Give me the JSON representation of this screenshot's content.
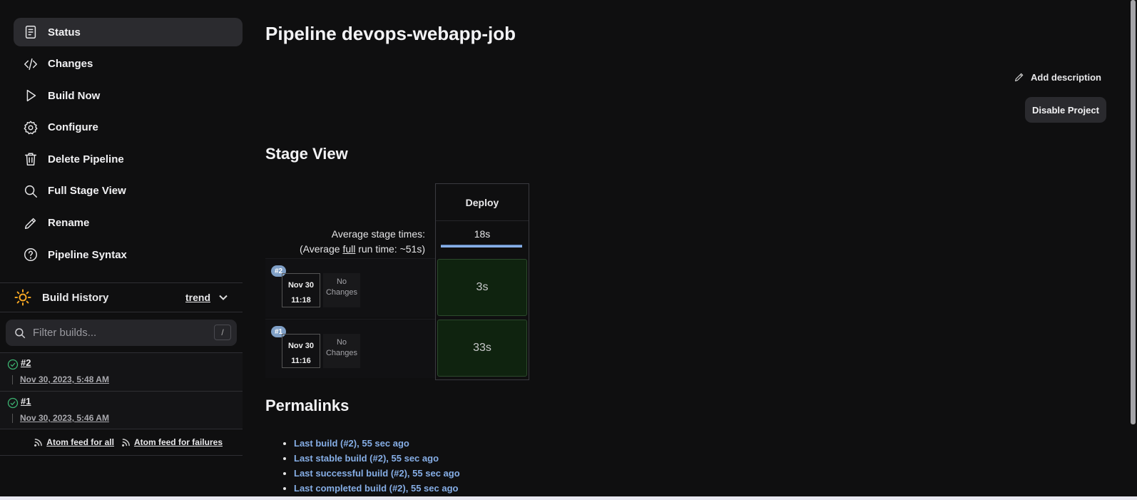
{
  "sidebar": {
    "tasks": [
      {
        "label": "Status",
        "icon": "document-icon"
      },
      {
        "label": "Changes",
        "icon": "code-icon"
      },
      {
        "label": "Build Now",
        "icon": "play-icon"
      },
      {
        "label": "Configure",
        "icon": "gear-icon"
      },
      {
        "label": "Delete Pipeline",
        "icon": "trash-icon"
      },
      {
        "label": "Full Stage View",
        "icon": "search-icon"
      },
      {
        "label": "Rename",
        "icon": "pencil-icon"
      },
      {
        "label": "Pipeline Syntax",
        "icon": "help-icon"
      }
    ],
    "build_history": {
      "title": "Build History",
      "trend": "trend",
      "filter_placeholder": "Filter builds...",
      "shortcut": "/",
      "builds": [
        {
          "number": "#2",
          "date": "Nov 30, 2023, 5:48 AM"
        },
        {
          "number": "#1",
          "date": "Nov 30, 2023, 5:46 AM"
        }
      ],
      "feed_all": "Atom feed for all",
      "feed_failures": "Atom feed for failures"
    }
  },
  "main": {
    "title": "Pipeline devops-webapp-job",
    "add_description": "Add description",
    "disable_project": "Disable Project",
    "stage_view": {
      "heading": "Stage View",
      "avg_label": "Average stage times:",
      "avg_full_prefix": "(Average ",
      "avg_full_word": "full",
      "avg_full_suffix": " run time: ~51s)",
      "stage": "Deploy",
      "avg_time": "18s",
      "runs": [
        {
          "badge": "#2",
          "date": "Nov 30",
          "time": "11:18",
          "changes_1": "No",
          "changes_2": "Changes",
          "duration": "3s"
        },
        {
          "badge": "#1",
          "date": "Nov 30",
          "time": "11:16",
          "changes_1": "No",
          "changes_2": "Changes",
          "duration": "33s"
        }
      ]
    },
    "permalinks": {
      "heading": "Permalinks",
      "links": [
        "Last build (#2), 55 sec ago",
        "Last stable build (#2), 55 sec ago",
        "Last successful build (#2), 55 sec ago",
        "Last completed build (#2), 55 sec ago"
      ]
    }
  },
  "colors": {
    "background": "#0f0f10",
    "link": "#86aee6",
    "success": "#3cb371",
    "stage_success": "#0f230f",
    "sun": "#f5a623"
  }
}
